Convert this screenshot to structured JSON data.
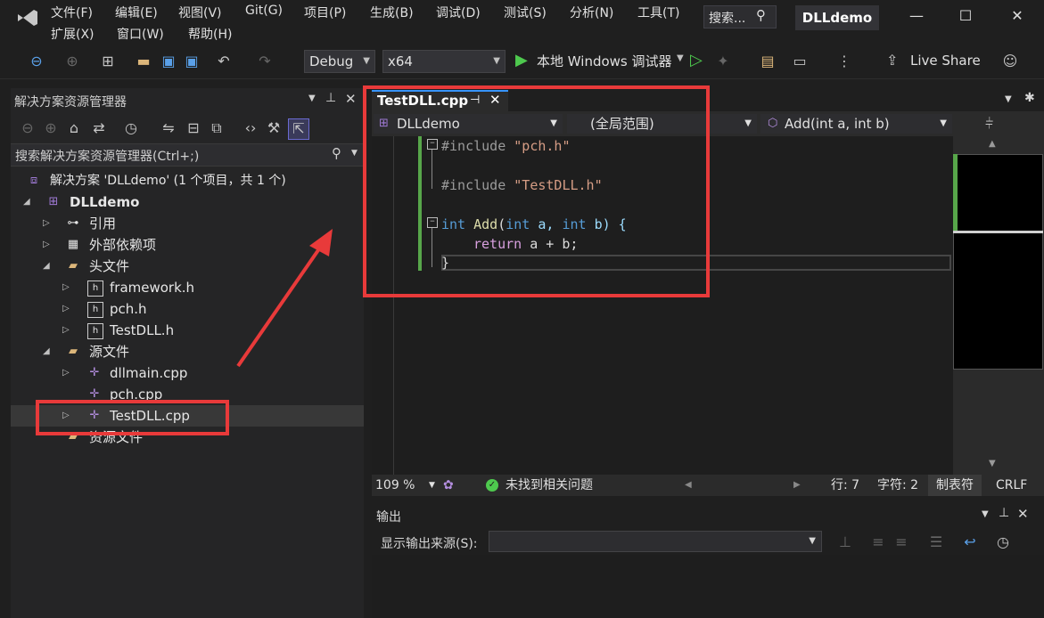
{
  "menu": {
    "row1": [
      "文件(F)",
      "编辑(E)",
      "视图(V)",
      "Git(G)",
      "项目(P)",
      "生成(B)",
      "调试(D)",
      "测试(S)",
      "分析(N)",
      "工具(T)"
    ],
    "row2": [
      "扩展(X)",
      "窗口(W)",
      "帮助(H)"
    ],
    "search_label": "搜索...",
    "project_name": "DLLdemo"
  },
  "toolbar": {
    "config": "Debug",
    "platform": "x64",
    "run_label": "本地 Windows 调试器",
    "live_share": "Live Share"
  },
  "solution_explorer": {
    "title": "解决方案资源管理器",
    "search_placeholder": "搜索解决方案资源管理器(Ctrl+;)",
    "items": [
      {
        "label": "解决方案 'DLLdemo' (1 个项目，共 1 个)"
      },
      {
        "label": "DLLdemo"
      },
      {
        "label": "引用"
      },
      {
        "label": "外部依赖项"
      },
      {
        "label": "头文件"
      },
      {
        "label": "framework.h"
      },
      {
        "label": "pch.h"
      },
      {
        "label": "TestDLL.h"
      },
      {
        "label": "源文件"
      },
      {
        "label": "dllmain.cpp"
      },
      {
        "label": "pch.cpp"
      },
      {
        "label": "TestDLL.cpp"
      },
      {
        "label": "资源文件"
      }
    ]
  },
  "editor": {
    "tab_name": "TestDLL.cpp",
    "nav_project": "DLLdemo",
    "nav_scope": "(全局范围)",
    "nav_member": "Add(int a, int b)",
    "code": {
      "l1_pp": "#include ",
      "l1_str": "\"pch.h\"",
      "l3_pp": "#include ",
      "l3_str": "\"TestDLL.h\"",
      "l5_kw1": "int",
      "l5_fn": "Add",
      "l5_p1": "(",
      "l5_kw2": "int",
      "l5_a": " a, ",
      "l5_kw3": "int",
      "l5_b": " b) {",
      "l6_kw": "return",
      "l6_rest": " a + b;",
      "l7": "}"
    }
  },
  "status": {
    "zoom": "109 %",
    "issues": "未找到相关问题",
    "line": "行: 7",
    "col": "字符: 2",
    "tabs": "制表符",
    "eol": "CRLF"
  },
  "output": {
    "title": "输出",
    "source_label": "显示输出来源(S):"
  },
  "colors": {
    "accent": "#3794ff",
    "annotation": "#e83a3a",
    "change_bar": "#57a64a"
  }
}
